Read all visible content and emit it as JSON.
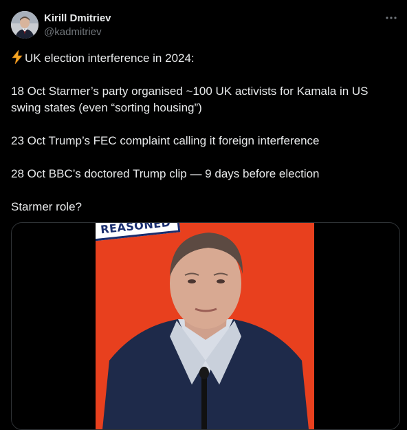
{
  "author": {
    "display_name": "Kirill Dmitriev",
    "handle": "@kadmitriev"
  },
  "actions": {
    "more_icon": "more-horizontal-icon"
  },
  "tweet": {
    "line1_emoji": "lightning-icon",
    "line1": "UK election interference in 2024:",
    "line2": "18 Oct Starmer’s party organised ~100 UK activists for Kamala in US swing states (even “sorting housing”)",
    "line3": "23 Oct Trump’s FEC complaint calling it foreign interference",
    "line4": "28 Oct BBC’s doctored Trump clip — 9 days before election",
    "line5": "Starmer role?"
  },
  "media": {
    "badge_text": "REASONED",
    "colors": {
      "background": "#e8401e",
      "badge_border": "#1a2e6e"
    }
  }
}
